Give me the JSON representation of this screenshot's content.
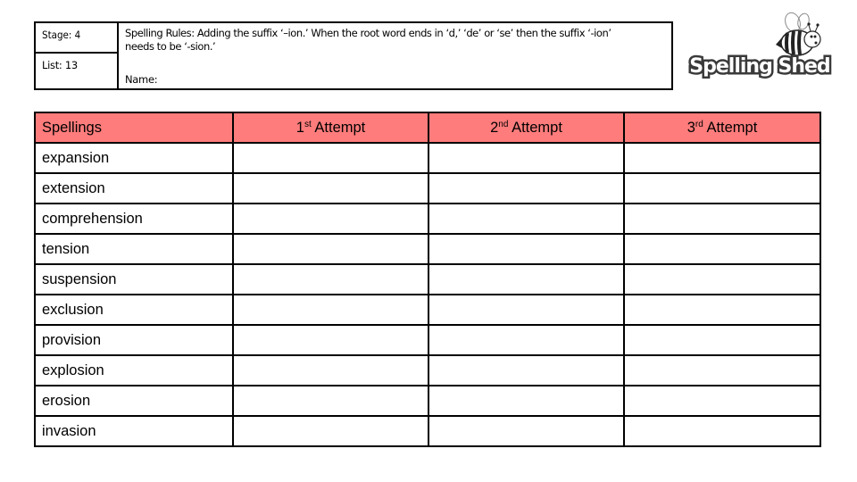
{
  "info": {
    "stage": "Stage: 4",
    "list": "List: 13",
    "rules_line1": "Spelling Rules:  Adding the suffix ‘–ion.’ When the root word ends in ‘d,’ ‘de’ or ‘se’ then the suffix ‘-ion’",
    "rules_line2": "needs to be ‘-sion.’",
    "name_label": "Name:"
  },
  "logo": {
    "text": "Spelling Shed",
    "icon": "bee-icon"
  },
  "table": {
    "header_color": "#ff7c7c",
    "headers": {
      "spellings": "Spellings",
      "attempt1_num": "1",
      "attempt1_sup": "st",
      "attempt2_num": "2",
      "attempt2_sup": "nd",
      "attempt3_num": "3",
      "attempt3_sup": "rd",
      "attempt_label": " Attempt"
    },
    "words": [
      "expansion",
      "extension",
      "comprehension",
      "tension",
      "suspension",
      "exclusion",
      "provision",
      "explosion",
      "erosion",
      "invasion"
    ]
  }
}
